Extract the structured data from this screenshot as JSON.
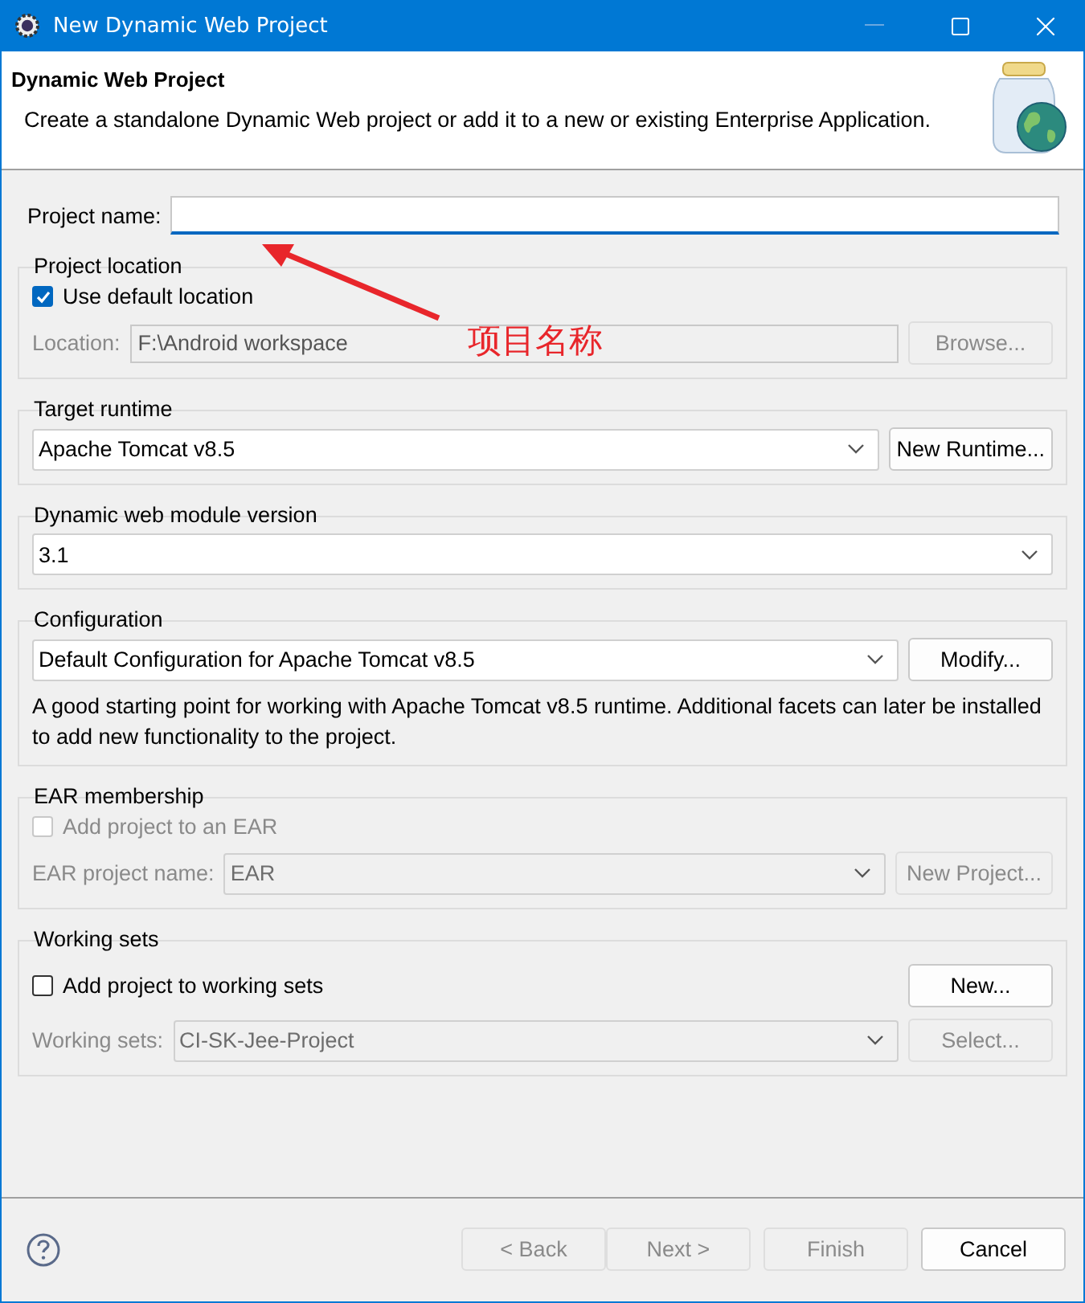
{
  "window": {
    "title": "New Dynamic Web Project"
  },
  "header": {
    "title": "Dynamic Web Project",
    "description": "Create a standalone Dynamic Web project or add it to a new or existing Enterprise Application."
  },
  "project_name": {
    "label": "Project name:",
    "focused": true
  },
  "project_location": {
    "legend": "Project location",
    "use_default": {
      "label": "Use default location",
      "checked": true,
      "disabled": false
    },
    "location": {
      "label": "Location:",
      "value": "F:\\Android workspace",
      "disabled": true
    },
    "browse": {
      "label": "Browse...",
      "disabled": true
    }
  },
  "target_runtime": {
    "legend": "Target runtime",
    "value": "Apache Tomcat v8.5",
    "button": {
      "label": "New Runtime...",
      "disabled": false
    }
  },
  "module_version": {
    "legend": "Dynamic web module version",
    "value": "3.1"
  },
  "configuration": {
    "legend": "Configuration",
    "value": "Default Configuration for Apache Tomcat v8.5",
    "button": {
      "label": "Modify...",
      "disabled": false
    },
    "description": "A good starting point for working with Apache Tomcat v8.5 runtime. Additional facets can later be installed to add new functionality to the project."
  },
  "ear_membership": {
    "legend": "EAR membership",
    "add": {
      "label": "Add project to an EAR",
      "checked": false,
      "disabled": true
    },
    "name": {
      "label": "EAR project name:",
      "value": "EAR",
      "disabled": true
    },
    "button": {
      "label": "New Project...",
      "disabled": true
    }
  },
  "working_sets": {
    "legend": "Working sets",
    "add": {
      "label": "Add project to working sets",
      "checked": false,
      "disabled": false
    },
    "new_button": {
      "label": "New...",
      "disabled": false
    },
    "sets": {
      "label": "Working sets:",
      "value": "CI-SK-Jee-Project",
      "disabled": true
    },
    "select_button": {
      "label": "Select...",
      "disabled": true
    }
  },
  "annotation": {
    "text": "项目名称"
  },
  "buttons": [
    {
      "label": "< Back",
      "disabled": true
    },
    {
      "label": "Next >",
      "disabled": true
    },
    {
      "label": "Finish",
      "disabled": true
    },
    {
      "label": "Cancel",
      "disabled": false
    }
  ]
}
